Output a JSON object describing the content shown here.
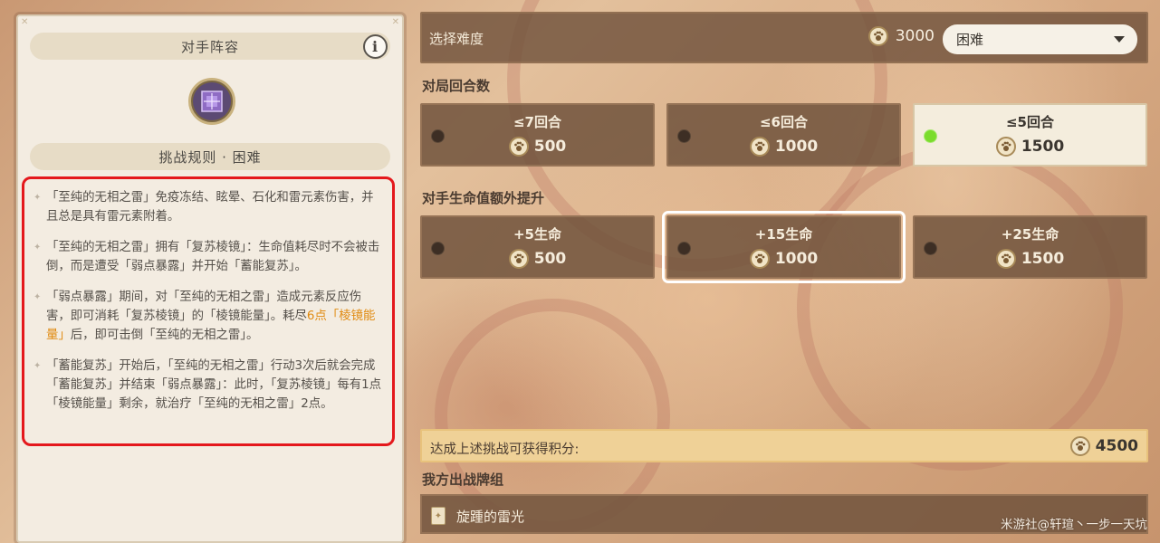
{
  "left_panel": {
    "opponent_title": "对手阵容",
    "info_icon": "i",
    "rules_title": "挑战规则 · 困难",
    "rules": [
      {
        "parts": [
          {
            "t": "「至纯的无相之雷」免疫冻结、眩晕、石化和雷元素伤害，并且总是具有雷元素附着。",
            "hl": false
          }
        ]
      },
      {
        "parts": [
          {
            "t": "「至纯的无相之雷」拥有「复苏棱镜」：生命值耗尽时不会被击倒，而是遭受「弱点暴露」并开始「蓄能复苏」。",
            "hl": false
          }
        ]
      },
      {
        "parts": [
          {
            "t": "「弱点暴露」期间，对「至纯的无相之雷」造成元素反应伤害，即可消耗「复苏棱镜」的「棱镜能量」。耗尽",
            "hl": false
          },
          {
            "t": "6点「棱镜能量」",
            "hl": true
          },
          {
            "t": "后，即可击倒「至纯的无相之雷」。",
            "hl": false
          }
        ]
      },
      {
        "parts": [
          {
            "t": "「蓄能复苏」开始后，「至纯的无相之雷」行动3次后就会完成「蓄能复苏」并结束「弱点暴露」：此时，「复苏棱镜」每有1点「棱镜能量」剩余，就治疗「至纯的无相之雷」2点。",
            "hl": false
          }
        ]
      }
    ]
  },
  "difficulty": {
    "label": "选择难度",
    "cost": "3000",
    "selected": "困难"
  },
  "rounds": {
    "label": "对局回合数",
    "options": [
      {
        "label": "≤7回合",
        "cost": "500",
        "selected": false
      },
      {
        "label": "≤6回合",
        "cost": "1000",
        "selected": false
      },
      {
        "label": "≤5回合",
        "cost": "1500",
        "selected": true
      }
    ]
  },
  "hp_boost": {
    "label": "对手生命值额外提升",
    "options": [
      {
        "label": "+5生命",
        "cost": "500",
        "selected": false
      },
      {
        "label": "+15生命",
        "cost": "1000",
        "selected": false,
        "highlighted": true
      },
      {
        "label": "+25生命",
        "cost": "1500",
        "selected": false
      }
    ]
  },
  "score": {
    "label": "达成上述挑战可获得积分:",
    "value": "4500"
  },
  "deck": {
    "label": "我方出战牌组",
    "name": "旋踵的雷光"
  },
  "watermark": "米游社@轩瑄丶一步一天坑",
  "colors": {
    "highlight_text": "#e08a10",
    "red_outline": "#e4181c",
    "selected_radio": "#7bdc2c"
  }
}
